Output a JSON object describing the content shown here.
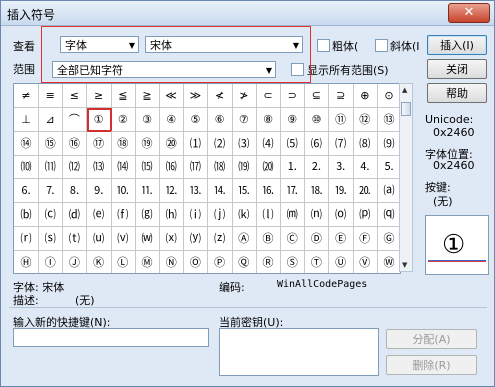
{
  "window": {
    "title": "插入符号",
    "close_glyph": "✕"
  },
  "font": {
    "label": "查看",
    "type_value": "字体",
    "name_value": "宋体"
  },
  "style": {
    "bold": "粗体(",
    "italic": "斜体(I"
  },
  "range": {
    "label": "范围",
    "value": "全部已知字符",
    "show_all": "显示所有范围(S)"
  },
  "buttons": {
    "insert": "插入(I)",
    "close": "关闭",
    "help": "帮助",
    "assign": "分配(A)",
    "delete": "删除(R)"
  },
  "info": {
    "unicode_label": "Unicode:",
    "unicode_value": "0x2460",
    "pos_label": "字体位置:",
    "pos_value": "0x2460",
    "key_label": "按键:",
    "key_value": "(无)",
    "font_line": "字体: 宋体",
    "desc_label": "描述:",
    "desc_value": "(无)",
    "encoding_label": "编码:",
    "encoding_value": "WinAllCodePages"
  },
  "shortcut": {
    "new_label": "输入新的快捷键(N):",
    "current_label": "当前密钥(U):"
  },
  "preview": {
    "glyph": "①"
  },
  "grid": {
    "selected_row": 1,
    "selected_col": 3,
    "rows": [
      [
        "≠",
        "≡",
        "≤",
        "≥",
        "≦",
        "≧",
        "≪",
        "≫",
        "≮",
        "≯",
        "⊂",
        "⊃",
        "⊆",
        "⊇",
        "⊕",
        "⊙"
      ],
      [
        "⊥",
        "⊿",
        "⌒",
        "①",
        "②",
        "③",
        "④",
        "⑤",
        "⑥",
        "⑦",
        "⑧",
        "⑨",
        "⑩",
        "⑪",
        "⑫",
        "⑬"
      ],
      [
        "⑭",
        "⑮",
        "⑯",
        "⑰",
        "⑱",
        "⑲",
        "⑳",
        "⑴",
        "⑵",
        "⑶",
        "⑷",
        "⑸",
        "⑹",
        "⑺",
        "⑻",
        "⑼"
      ],
      [
        "⑽",
        "⑾",
        "⑿",
        "⒀",
        "⒁",
        "⒂",
        "⒃",
        "⒄",
        "⒅",
        "⒆",
        "⒇",
        "⒈",
        "⒉",
        "⒊",
        "⒋",
        "⒌"
      ],
      [
        "⒍",
        "⒎",
        "⒏",
        "⒐",
        "⒑",
        "⒒",
        "⒓",
        "⒔",
        "⒕",
        "⒖",
        "⒗",
        "⒘",
        "⒙",
        "⒚",
        "⒛",
        "⒜"
      ],
      [
        "⒝",
        "⒞",
        "⒟",
        "⒠",
        "⒡",
        "⒢",
        "⒣",
        "⒤",
        "⒥",
        "⒦",
        "⒧",
        "⒨",
        "⒩",
        "⒪",
        "⒫",
        "⒬"
      ],
      [
        "⒭",
        "⒮",
        "⒯",
        "⒰",
        "⒱",
        "⒲",
        "⒳",
        "⒴",
        "⒵",
        "Ⓐ",
        "Ⓑ",
        "Ⓒ",
        "Ⓓ",
        "Ⓔ",
        "Ⓕ",
        "Ⓖ"
      ],
      [
        "Ⓗ",
        "Ⓘ",
        "Ⓙ",
        "Ⓚ",
        "Ⓛ",
        "Ⓜ",
        "Ⓝ",
        "Ⓞ",
        "Ⓟ",
        "Ⓠ",
        "Ⓡ",
        "Ⓢ",
        "Ⓣ",
        "Ⓤ",
        "Ⓥ",
        "Ⓦ"
      ]
    ]
  }
}
